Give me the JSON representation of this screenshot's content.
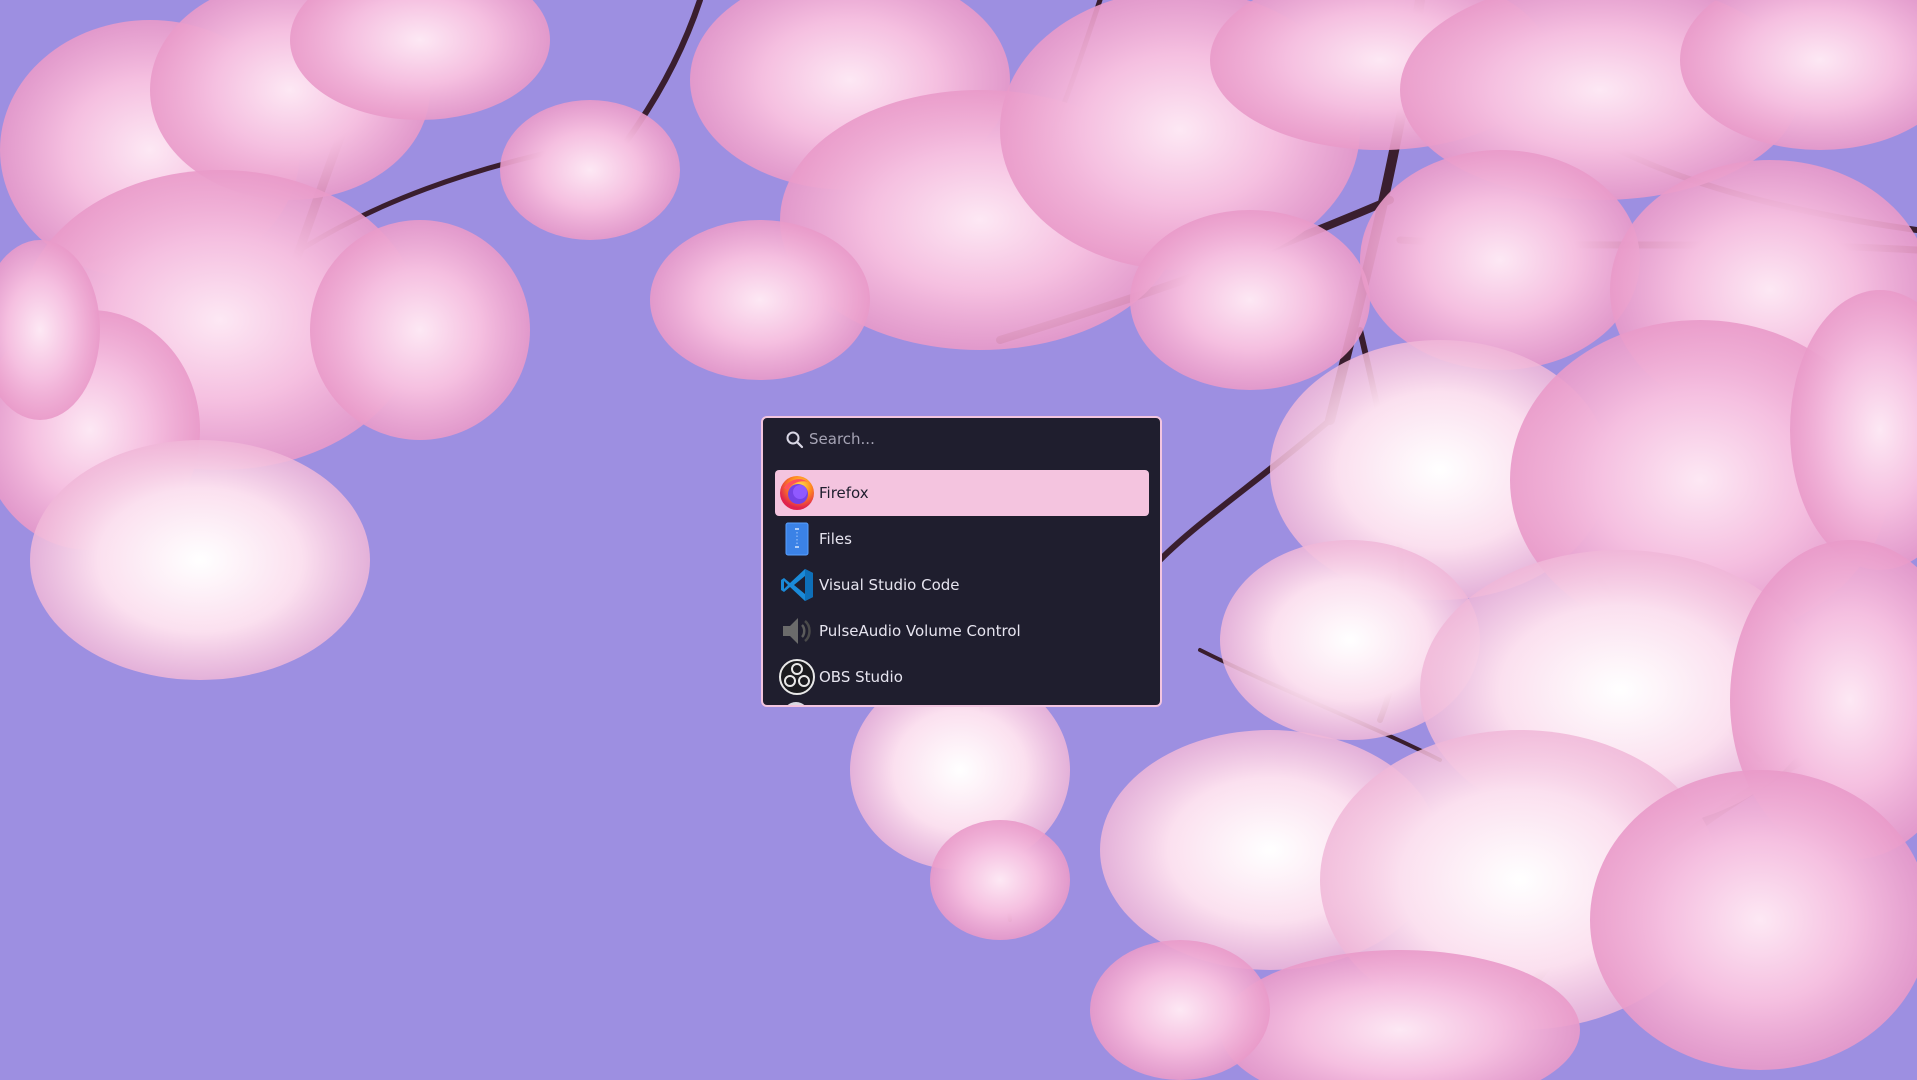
{
  "launcher": {
    "search": {
      "placeholder": "Search...",
      "value": ""
    },
    "apps": [
      {
        "label": "Firefox",
        "icon": "firefox-icon",
        "selected": true
      },
      {
        "label": "Files",
        "icon": "files-icon",
        "selected": false
      },
      {
        "label": "Visual Studio Code",
        "icon": "vscode-icon",
        "selected": false
      },
      {
        "label": "PulseAudio Volume Control",
        "icon": "speaker-icon",
        "selected": false
      },
      {
        "label": "OBS Studio",
        "icon": "obs-icon",
        "selected": false
      }
    ]
  },
  "colors": {
    "wallpaper_sky": "#9e8fe0",
    "launcher_bg": "#1f1e2e",
    "launcher_border": "#f3c5df",
    "selection": "#f4c4df",
    "text": "#e6e4ef"
  }
}
